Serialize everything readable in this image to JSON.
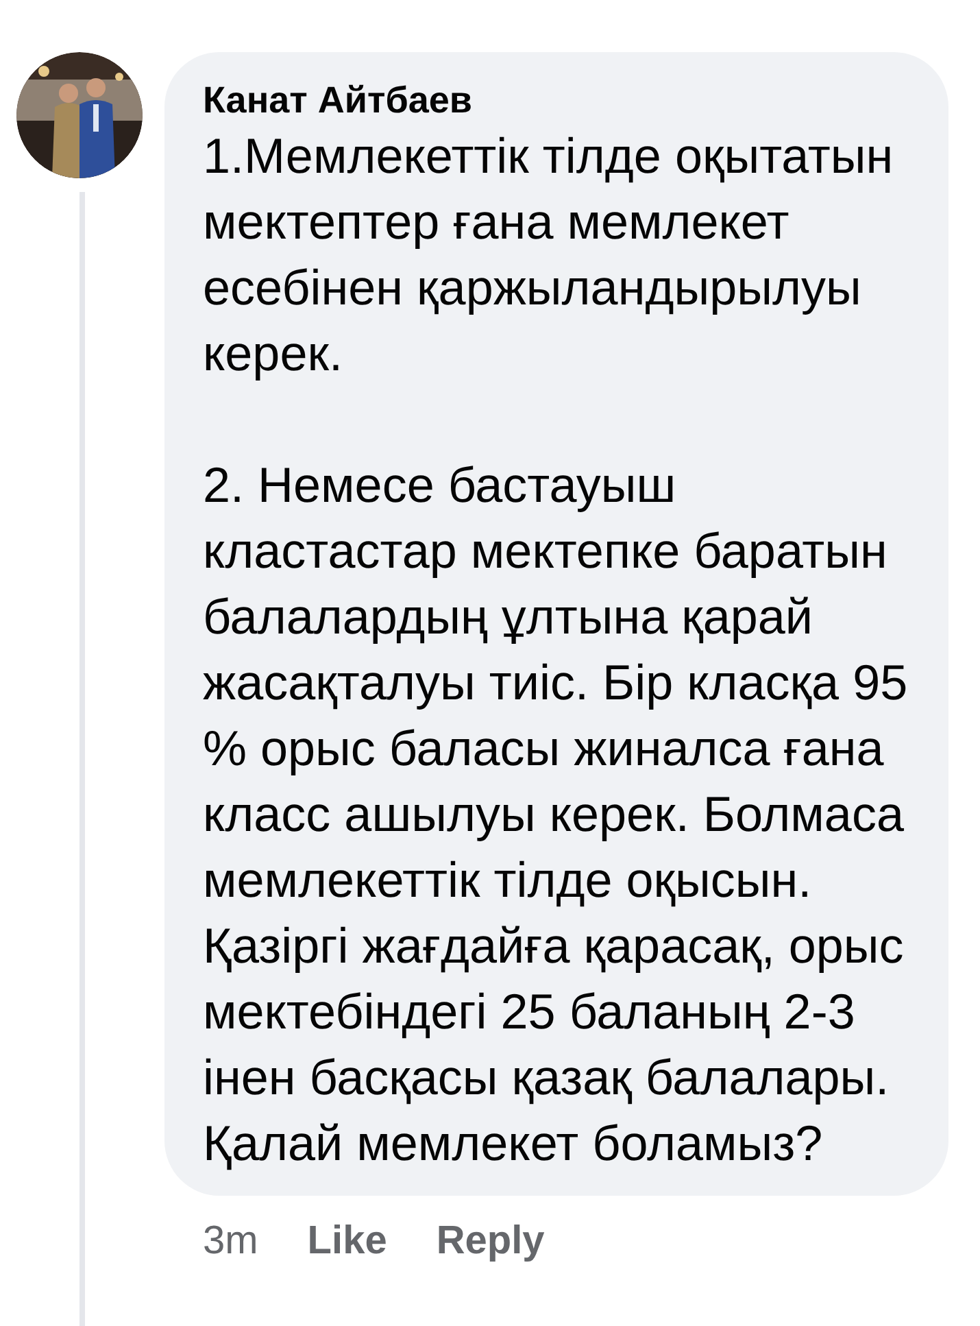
{
  "comment": {
    "author": "Канат Айтбаев",
    "paragraphs": [
      "1.Мемлекеттік тілде оқытатын мектептер ғана мемлекет есебінен қаржыландырылуы керек.",
      "2. Немесе бастауыш кластастар мектепке баратын балалардың ұлтына қарай жасақталуы тиіс. Бір класқа 95 % орыс баласы жиналса ғана класс ашылуы керек. Болмаса мемлекеттік тілде оқысын. Қазіргі жағдайға қарасақ, орыс мектебіндегі 25 баланың 2-3 інен басқасы қазақ балалары.",
      "Қалай мемлекет боламыз?"
    ],
    "time": "3m",
    "actions": [
      "Like",
      "Reply"
    ]
  }
}
